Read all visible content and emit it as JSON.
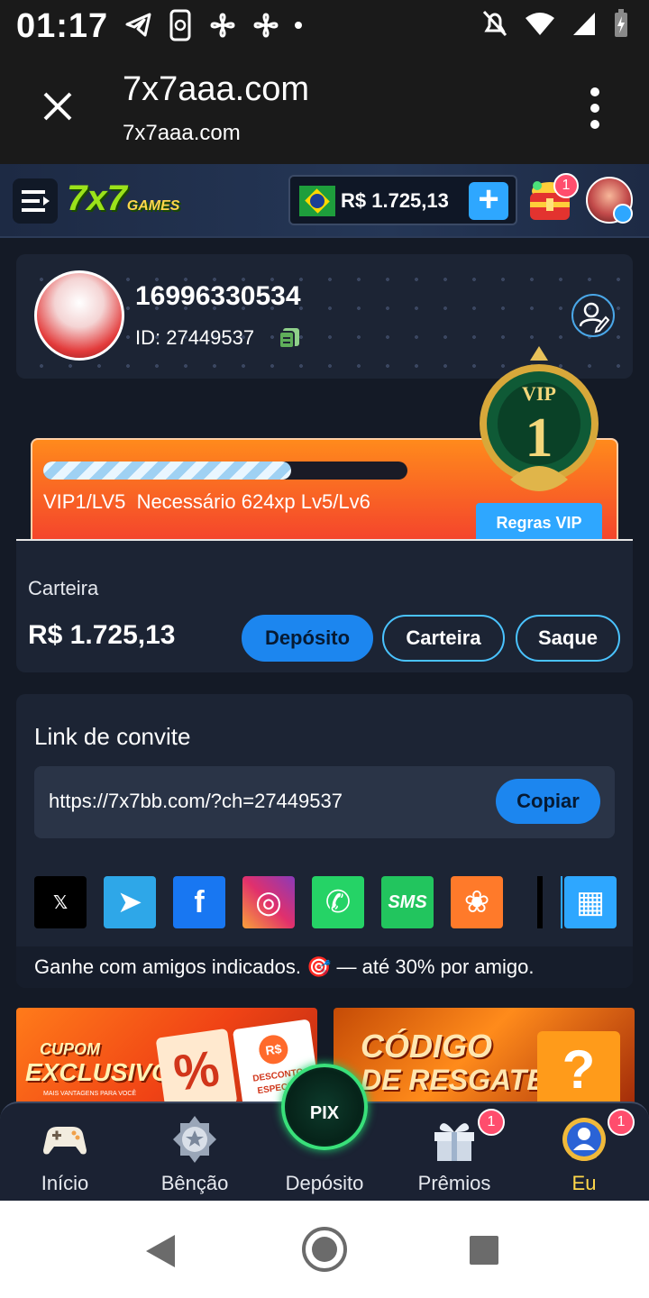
{
  "status_bar": {
    "time": "01:17",
    "left_icons": [
      "telegram-icon",
      "phone-sync-icon",
      "fan-icon",
      "fan-icon",
      "dot-icon"
    ],
    "right_icons": [
      "mute-icon",
      "wifi-icon",
      "signal-icon",
      "battery-icon"
    ]
  },
  "browser": {
    "title": "7x7aaa.com",
    "url": "7x7aaa.com"
  },
  "header": {
    "logo_main": "7x7",
    "logo_sub": "GAMES",
    "balance": "R$ 1.725,13",
    "chest_badge": "1"
  },
  "profile": {
    "name": "16996330534",
    "id_text": "ID: 27449537"
  },
  "vip": {
    "progress": 0.68,
    "level_text": "VIP1/LV5",
    "needed_text": "Necessário 624xp Lv5/Lv6",
    "rules_label": "Regras VIP",
    "badge_label": "VIP",
    "badge_number": "1"
  },
  "wallet": {
    "label": "Carteira",
    "amount": "R$ 1.725,13",
    "deposit_label": "Depósito",
    "wallet_label": "Carteira",
    "withdraw_label": "Saque"
  },
  "invite": {
    "title": "Link de convite",
    "link": "https://7x7bb.com/?ch=27449537",
    "copy_label": "Copiar",
    "share": [
      {
        "name": "x",
        "color": "#000000",
        "glyph": "𝕏"
      },
      {
        "name": "telegram",
        "color": "#2ea7e8",
        "glyph": "➤"
      },
      {
        "name": "facebook",
        "color": "#1877f2",
        "glyph": "f"
      },
      {
        "name": "instagram",
        "color": "#e1306c",
        "glyph": "◎"
      },
      {
        "name": "whatsapp",
        "color": "#25d366",
        "glyph": "✆"
      },
      {
        "name": "sms",
        "color": "#22c55e",
        "glyph": "SMS"
      },
      {
        "name": "kwai",
        "color": "#ff7a2a",
        "glyph": "❀"
      },
      {
        "name": "more",
        "color": "#2ea7ff",
        "glyph": "▦"
      }
    ],
    "footer": "Ganhe com amigos indicados. 🎯 — até 30% por amigo."
  },
  "banners": [
    {
      "title_line1": "CUPOM",
      "title_line2": "EXCLUSIVO",
      "sub": "MAIS VANTAGENS PARA VOCÊ",
      "ticket_line1": "DESCONTO",
      "ticket_line2": "ESPECIAL"
    },
    {
      "title_line1": "CÓDIGO",
      "title_line2": "DE RESGATE"
    }
  ],
  "bottom_nav": {
    "items": [
      {
        "label": "Início",
        "icon": "gamepad-icon"
      },
      {
        "label": "Bênção",
        "icon": "medal-icon"
      },
      {
        "label": "Depósito",
        "icon": "pix-icon"
      },
      {
        "label": "Prêmios",
        "icon": "gift-icon",
        "badge": "1"
      },
      {
        "label": "Eu",
        "icon": "user-badge-icon",
        "badge": "1"
      }
    ],
    "active_color": "#ffd84a",
    "pix_label": "PIX"
  }
}
